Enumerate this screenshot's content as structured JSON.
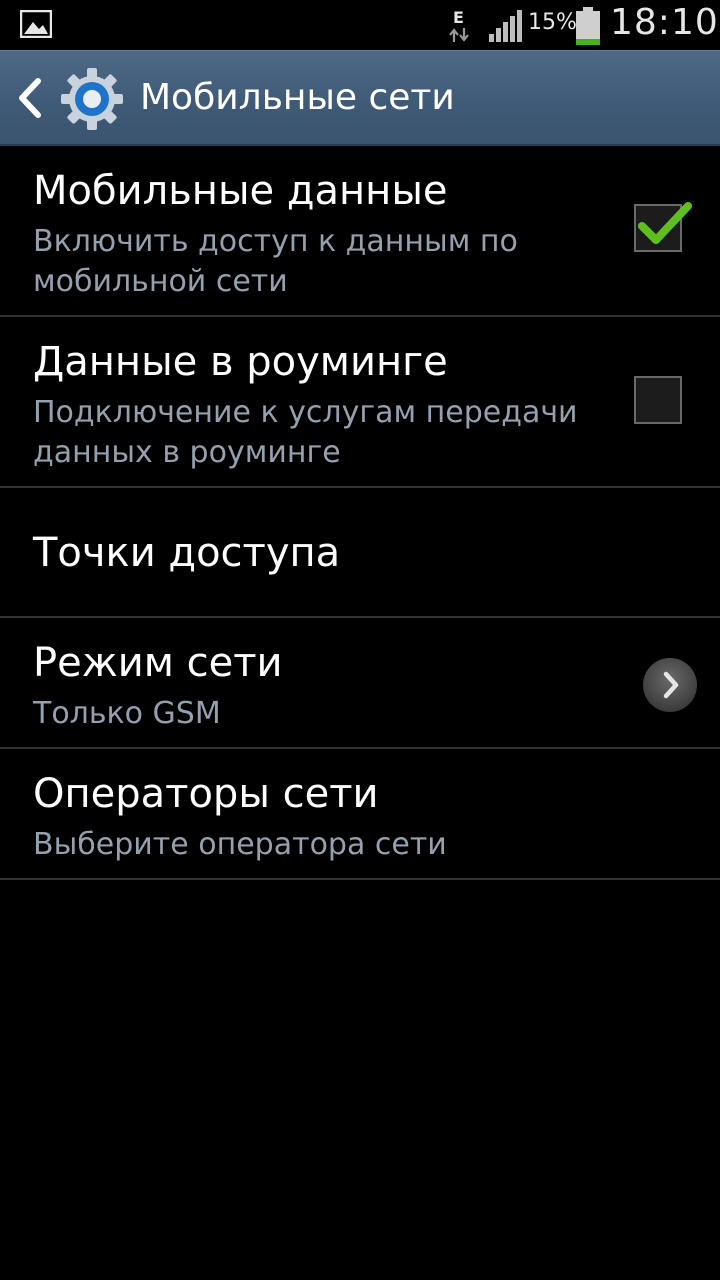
{
  "status_bar": {
    "network_type": "E",
    "battery_percent": "15%",
    "time": "18:10",
    "icons": [
      "gallery-icon",
      "network-activity-icon",
      "signal-icon",
      "battery-icon"
    ]
  },
  "action_bar": {
    "title": "Мобильные сети",
    "accent_color": "#3f5a76"
  },
  "settings": [
    {
      "title": "Мобильные данные",
      "summary": "Включить доступ к данным по мобильной сети",
      "control": "checkbox",
      "checked": true
    },
    {
      "title": "Данные в роуминге",
      "summary": "Подключение к услугам передачи данных в роуминге",
      "control": "checkbox",
      "checked": false
    },
    {
      "title": "Точки доступа",
      "summary": "",
      "control": "none"
    },
    {
      "title": "Режим сети",
      "summary": "Только GSM",
      "control": "chevron"
    },
    {
      "title": "Операторы сети",
      "summary": "Выберите оператора сети",
      "control": "none"
    }
  ],
  "colors": {
    "summary_text": "#93a0ad",
    "check_green": "#5fbf1f",
    "divider": "#333333"
  }
}
